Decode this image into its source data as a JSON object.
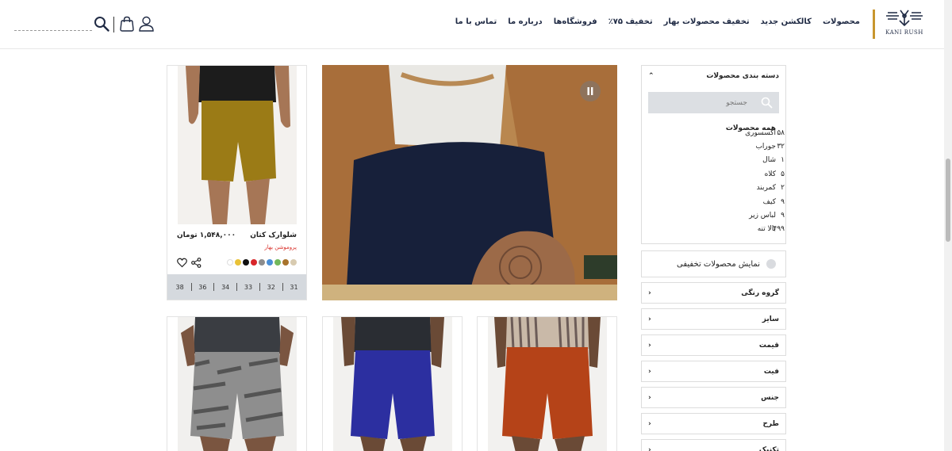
{
  "brand": {
    "name": "KANI RUSH",
    "accent": "#c8962e",
    "navy": "#1f2a44"
  },
  "nav": [
    "محصولات",
    "کالکشن جدید",
    "تخفیف محصولات بهار",
    "تخفیف ۷۵٪",
    "فروشگاه‌ها",
    "درباره ما",
    "تماس با ما"
  ],
  "header_icons": [
    "search-icon",
    "bag-icon",
    "user-icon"
  ],
  "sidebar": {
    "category_title": "دسته بندی محصولات",
    "search_placeholder": "جستجو",
    "all_label": "همه محصولات",
    "categories": [
      {
        "label": "اکسسوری",
        "count": "۵۸"
      },
      {
        "label": "جوراب",
        "count": "۳۲"
      },
      {
        "label": "شال",
        "count": "۱"
      },
      {
        "label": "کلاه",
        "count": "۵"
      },
      {
        "label": "کمربند",
        "count": "۲"
      },
      {
        "label": "کیف",
        "count": "۹"
      },
      {
        "label": "لباس زیر",
        "count": "۹"
      },
      {
        "label": "بالا تنه",
        "count": "۴۹۹"
      }
    ],
    "discount_label": "نمایش محصولات تخفیفی",
    "filters": [
      "گروه رنگی",
      "سایز",
      "قیمت",
      "فیت",
      "جنس",
      "طرح",
      "تکنیک"
    ]
  },
  "product": {
    "name": "شلوارک کتان",
    "price": "۱,۵۴۸,۰۰۰ تومان",
    "promo": "پروموشن بهار",
    "colors": [
      "#d8cbb0",
      "#a8732c",
      "#72b85c",
      "#4a8fd6",
      "#8d8d8d",
      "#d8262a",
      "#111111",
      "#e9c238",
      "#ffffff"
    ],
    "sizes": [
      "31",
      "32",
      "33",
      "34",
      "36",
      "38"
    ]
  },
  "product_photos": {
    "card1": {
      "shorts": "#9b7b16",
      "shirt": "#1c1c1c"
    },
    "card2": {
      "shorts": "#8e8e8e",
      "shirt": "#3a3d42"
    },
    "card3": {
      "shorts": "#2c2fa0",
      "shirt": "#2a2d33"
    },
    "card4": {
      "shorts": "#b54318",
      "shirt": "#c9b9a8"
    }
  }
}
